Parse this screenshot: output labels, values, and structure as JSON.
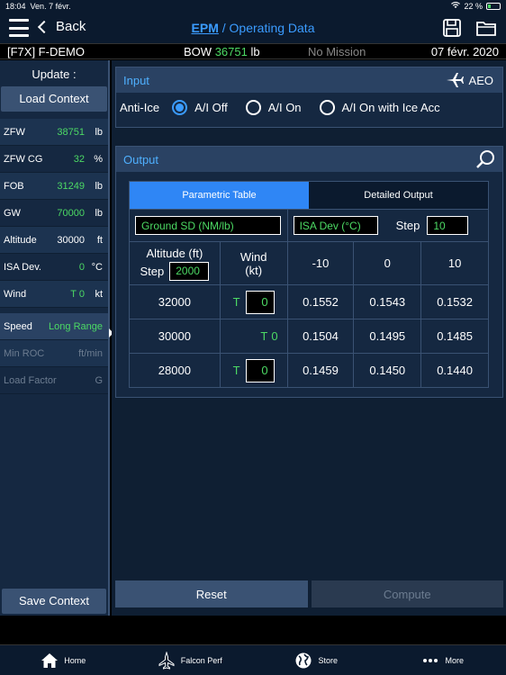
{
  "status": {
    "time": "18:04",
    "date": "Ven. 7 févr.",
    "battery": "22 %"
  },
  "nav": {
    "back_label": "Back",
    "title": "EPM",
    "subtitle": "/ Operating Data"
  },
  "info": {
    "aircraft": "[F7X]  F-DEMO",
    "bow_label": "BOW",
    "bow_value": "36751",
    "bow_unit": "lb",
    "mission": "No Mission",
    "date": "07 févr. 2020"
  },
  "sidebar": {
    "update_label": "Update :",
    "load_context": "Load Context",
    "save_context": "Save Context",
    "rows": [
      {
        "label": "ZFW",
        "value": "38751",
        "unit": "lb"
      },
      {
        "label": "ZFW CG",
        "value": "32",
        "unit": "%"
      },
      {
        "label": "FOB",
        "value": "31249",
        "unit": "lb"
      },
      {
        "label": "GW",
        "value": "70000",
        "unit": "lb"
      },
      {
        "label": "Altitude",
        "value": "30000",
        "unit": "ft"
      },
      {
        "label": "ISA Dev.",
        "value": "0",
        "unit": "°C"
      },
      {
        "label": "Wind",
        "value": "T 0",
        "unit": "kt"
      }
    ],
    "speed_label": "Speed",
    "speed_value": "Long Range",
    "min_roc_label": "Min ROC",
    "min_roc_unit": "ft/min",
    "load_factor_label": "Load Factor",
    "load_factor_unit": "G"
  },
  "input": {
    "title": "Input",
    "mode": "AEO",
    "anti_ice_label": "Anti-Ice",
    "options": [
      "A/I Off",
      "A/I On",
      "A/I On with Ice Acc"
    ],
    "selected": 0
  },
  "output": {
    "title": "Output",
    "tabs": [
      "Parametric Table",
      "Detailed Output"
    ],
    "active_tab": 0,
    "param_field": "Ground SD (NM/lb)",
    "isa_field": "ISA Dev (°C)",
    "step_label": "Step",
    "step_value": "10",
    "alt_header": "Altitude (ft)",
    "alt_step_label": "Step",
    "alt_step_value": "2000",
    "wind_header": "Wind\n(kt)",
    "columns": [
      "-10",
      "0",
      "10"
    ],
    "rows": [
      {
        "altitude": "32000",
        "wind_prefix": "T",
        "wind": "0",
        "wind_editable": true,
        "values": [
          "0.1552",
          "0.1543",
          "0.1532"
        ]
      },
      {
        "altitude": "30000",
        "wind_prefix": "T",
        "wind": "0",
        "wind_editable": false,
        "values": [
          "0.1504",
          "0.1495",
          "0.1485"
        ]
      },
      {
        "altitude": "28000",
        "wind_prefix": "T",
        "wind": "0",
        "wind_editable": true,
        "values": [
          "0.1459",
          "0.1450",
          "0.1440"
        ]
      }
    ]
  },
  "buttons": {
    "reset": "Reset",
    "compute": "Compute"
  },
  "tabbar": {
    "home": "Home",
    "falcon_perf": "Falcon Perf",
    "store": "Store",
    "more": "More"
  }
}
